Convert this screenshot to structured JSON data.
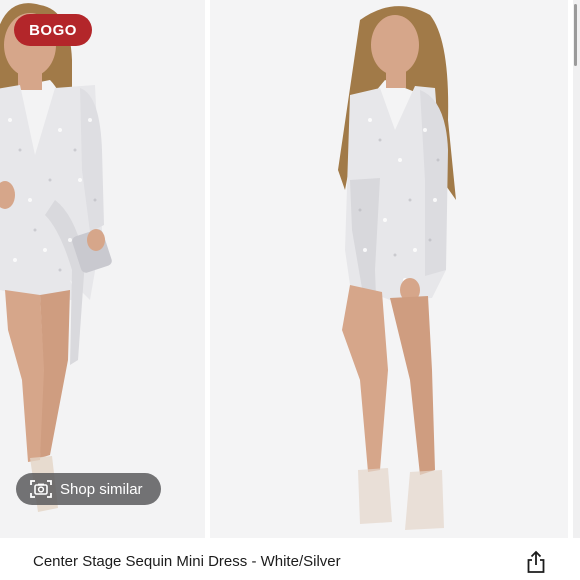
{
  "listing": {
    "badge": "BOGO",
    "shop_similar_label": "Shop similar",
    "product_title": "Center Stage Sequin Mini Dress - White/Silver",
    "photo_count_visible": 3
  },
  "icons": {
    "shop_similar": "camera-scan-icon",
    "share": "share-icon"
  },
  "colors": {
    "badge_bg": "#b3262a",
    "pill_bg": "#555558",
    "photo_bg": "#f4f4f5",
    "dress": "#e7e7ea",
    "skin": "#d6a68a",
    "hair": "#a17a48"
  }
}
